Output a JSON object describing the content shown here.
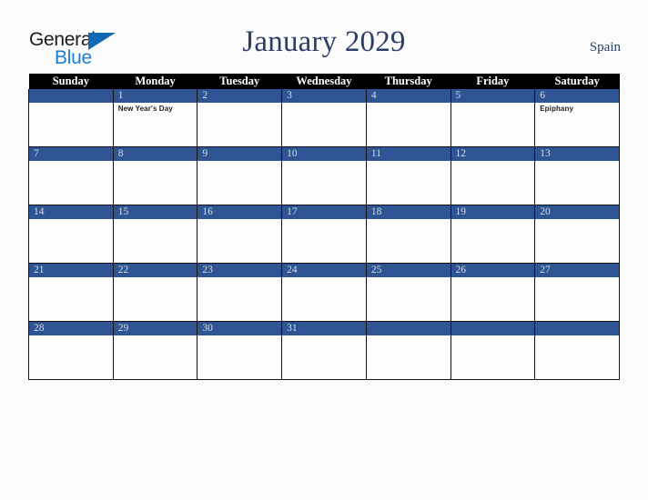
{
  "brand": {
    "name_part1": "General",
    "name_part2": "Blue",
    "accent_color": "#1a7fd4",
    "triangle_color": "#1268b3",
    "triangle_icon": "triangle-icon"
  },
  "header": {
    "title": "January 2029",
    "country": "Spain",
    "title_color": "#2b3f67"
  },
  "calendar": {
    "month": "January",
    "year": "2029",
    "day_headers": [
      "Sunday",
      "Monday",
      "Tuesday",
      "Wednesday",
      "Thursday",
      "Friday",
      "Saturday"
    ],
    "header_bg": "#000000",
    "daybar_bg": "#2e5494",
    "daynumber_color": "#d9dde6",
    "weeks": [
      [
        {
          "date": "",
          "event": ""
        },
        {
          "date": "1",
          "event": "New Year's Day"
        },
        {
          "date": "2",
          "event": ""
        },
        {
          "date": "3",
          "event": ""
        },
        {
          "date": "4",
          "event": ""
        },
        {
          "date": "5",
          "event": ""
        },
        {
          "date": "6",
          "event": "Epiphany"
        }
      ],
      [
        {
          "date": "7",
          "event": ""
        },
        {
          "date": "8",
          "event": ""
        },
        {
          "date": "9",
          "event": ""
        },
        {
          "date": "10",
          "event": ""
        },
        {
          "date": "11",
          "event": ""
        },
        {
          "date": "12",
          "event": ""
        },
        {
          "date": "13",
          "event": ""
        }
      ],
      [
        {
          "date": "14",
          "event": ""
        },
        {
          "date": "15",
          "event": ""
        },
        {
          "date": "16",
          "event": ""
        },
        {
          "date": "17",
          "event": ""
        },
        {
          "date": "18",
          "event": ""
        },
        {
          "date": "19",
          "event": ""
        },
        {
          "date": "20",
          "event": ""
        }
      ],
      [
        {
          "date": "21",
          "event": ""
        },
        {
          "date": "22",
          "event": ""
        },
        {
          "date": "23",
          "event": ""
        },
        {
          "date": "24",
          "event": ""
        },
        {
          "date": "25",
          "event": ""
        },
        {
          "date": "26",
          "event": ""
        },
        {
          "date": "27",
          "event": ""
        }
      ],
      [
        {
          "date": "28",
          "event": ""
        },
        {
          "date": "29",
          "event": ""
        },
        {
          "date": "30",
          "event": ""
        },
        {
          "date": "31",
          "event": ""
        },
        {
          "date": "",
          "event": ""
        },
        {
          "date": "",
          "event": ""
        },
        {
          "date": "",
          "event": ""
        }
      ]
    ]
  }
}
